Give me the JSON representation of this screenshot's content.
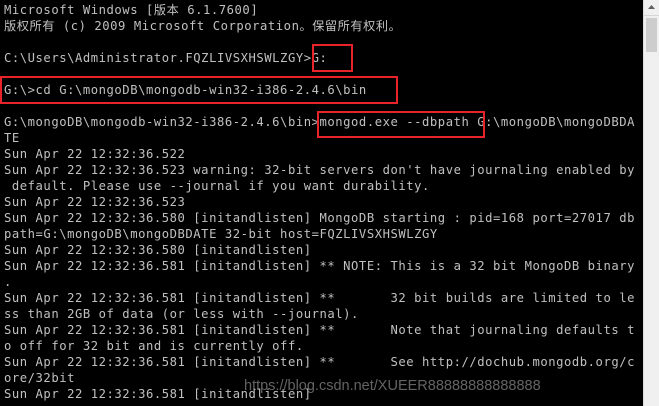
{
  "console": {
    "lines": [
      "Microsoft Windows [版本 6.1.7600]",
      "版权所有 (c) 2009 Microsoft Corporation。保留所有权利。",
      "",
      "C:\\Users\\Administrator.FQZLIVSXHSWLZGY>G:",
      "",
      "G:\\>cd G:\\mongoDB\\mongodb-win32-i386-2.4.6\\bin",
      "",
      "G:\\mongoDB\\mongodb-win32-i386-2.4.6\\bin>mongod.exe --dbpath G:\\mongoDB\\mongoDBDA",
      "TE",
      "Sun Apr 22 12:32:36.522",
      "Sun Apr 22 12:32:36.523 warning: 32-bit servers don't have journaling enabled by",
      " default. Please use --journal if you want durability.",
      "Sun Apr 22 12:32:36.523",
      "Sun Apr 22 12:32:36.580 [initandlisten] MongoDB starting : pid=168 port=27017 db",
      "path=G:\\mongoDB\\mongoDBDATE 32-bit host=FQZLIVSXHSWLZGY",
      "Sun Apr 22 12:32:36.580 [initandlisten]",
      "Sun Apr 22 12:32:36.581 [initandlisten] ** NOTE: This is a 32 bit MongoDB binary",
      ".",
      "Sun Apr 22 12:32:36.581 [initandlisten] **       32 bit builds are limited to le",
      "ss than 2GB of data (or less with --journal).",
      "Sun Apr 22 12:32:36.581 [initandlisten] **       Note that journaling defaults t",
      "o off for 32 bit and is currently off.",
      "Sun Apr 22 12:32:36.581 [initandlisten] **       See http://dochub.mongodb.org/c",
      "ore/32bit",
      "Sun Apr 22 12:32:36.581 [initandlisten]"
    ]
  },
  "watermark": "https://blog.csdn.net/XUEER88888888888888",
  "scrollbar": {
    "up_icon": "arrow-up-icon"
  },
  "colors": {
    "background": "#000000",
    "text": "#c0c0c0",
    "highlight": "#e8232a"
  }
}
